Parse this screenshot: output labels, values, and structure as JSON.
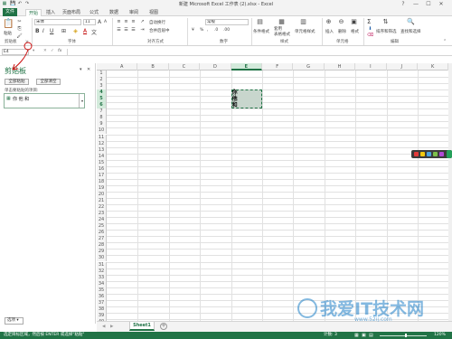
{
  "window": {
    "title": "新建 Microsoft Excel 工作表 (2).xlsx - Excel",
    "help": "?",
    "minimize": "—",
    "maximize": "☐",
    "close": "✕"
  },
  "quick_access": {
    "save": "💾",
    "undo": "↶",
    "redo": "↷"
  },
  "tabs": [
    "文件",
    "开始",
    "插入",
    "页面布局",
    "公式",
    "数据",
    "审阅",
    "视图"
  ],
  "ribbon": {
    "paste_label": "粘贴",
    "font_name": "宋体",
    "font_size": "11",
    "font_grow": "A",
    "font_shrink": "A",
    "bold": "B",
    "italic": "I",
    "underline": "U",
    "font_color_letter": "A",
    "wrap_text": "自动换行",
    "merge_center": "合并后居中",
    "number_format": "常规",
    "percent": "%",
    "comma": ",",
    "cond_format": "条件格式",
    "table_format": "套用\n表格格式",
    "cell_styles": "单元格样式",
    "insert": "插入",
    "delete": "删除",
    "format": "格式",
    "sum": "Σ",
    "sort_filter": "排序和筛选",
    "find_select": "查找和选择",
    "groups": {
      "clipboard": "剪贴板",
      "font": "字体",
      "alignment": "对齐方式",
      "number": "数字",
      "styles": "样式",
      "cells": "单元格",
      "editing": "编辑"
    }
  },
  "formula_bar": {
    "name_box": "E4",
    "fx": "fx",
    "cancel": "✕",
    "enter": "✓",
    "value": ""
  },
  "clipboard_pane": {
    "title": "剪贴板",
    "paste_all": "全部粘贴",
    "clear_all": "全部清空",
    "hint": "单击要粘贴的项目:",
    "item_text": "你 他 和",
    "options": "选项 ▾",
    "close": "✕",
    "menu": "▾"
  },
  "sheet": {
    "columns": [
      "A",
      "B",
      "C",
      "D",
      "E",
      "F",
      "G",
      "H",
      "I",
      "J",
      "K"
    ],
    "selected_column": "E",
    "rows": [
      "1",
      "2",
      "3",
      "4",
      "5",
      "6",
      "7",
      "8",
      "9",
      "10",
      "11",
      "12",
      "13",
      "14",
      "15",
      "16",
      "17",
      "18",
      "19",
      "20",
      "21",
      "22",
      "23",
      "24",
      "25",
      "26",
      "27",
      "28",
      "29",
      "30",
      "31",
      "32",
      "33",
      "34",
      "35",
      "36",
      "37",
      "38",
      "39",
      "40"
    ],
    "selected_rows": [
      "4",
      "5",
      "6"
    ],
    "cells": {
      "E4": "你",
      "E5": "他",
      "E6": "和"
    }
  },
  "sheet_tabs": {
    "active": "Sheet1",
    "add": "+",
    "prev": "◀",
    "next": "▶"
  },
  "status_bar": {
    "message": "选定目标区域，然后按 ENTER 或选择\"粘贴\"",
    "count": "计数: 3",
    "zoom": "120%"
  },
  "watermark": {
    "text": "我爱IT技术网",
    "url": "www.52ij.com"
  },
  "colors": {
    "excel_green": "#217346",
    "selection_fill": "#d3eadb",
    "annotation_red": "#cc1111"
  }
}
